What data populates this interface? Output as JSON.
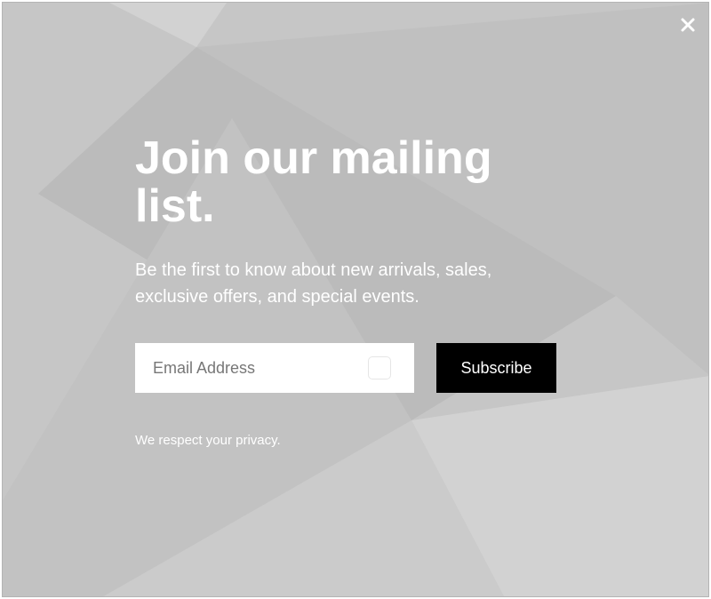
{
  "popup": {
    "heading": "Join our mailing list.",
    "subtitle": "Be the first to know about new arrivals, sales, exclusive offers, and special events.",
    "email_placeholder": "Email Address",
    "email_value": "",
    "subscribe_label": "Subscribe",
    "privacy_note": "We respect your privacy.",
    "close_icon": "close-icon"
  },
  "colors": {
    "background": "#c6c6c6",
    "text": "#ffffff",
    "button_background": "#000000",
    "button_text": "#ffffff",
    "input_background": "#ffffff"
  }
}
